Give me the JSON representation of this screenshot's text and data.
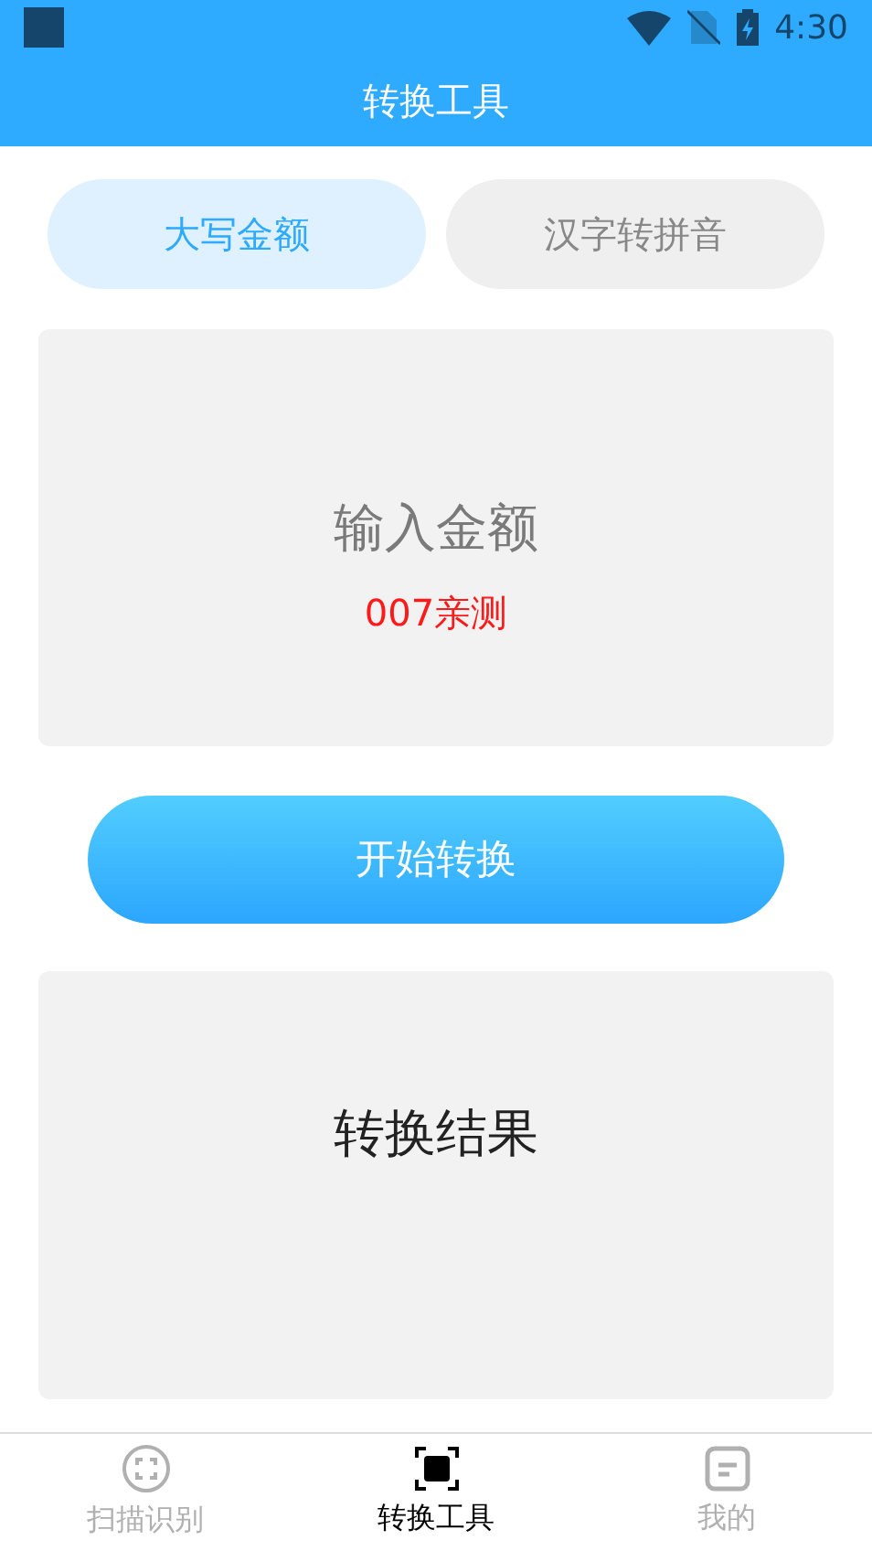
{
  "status_bar": {
    "time": "4:30"
  },
  "header": {
    "title": "转换工具"
  },
  "tabs": [
    {
      "label": "大写金额",
      "selected": true
    },
    {
      "label": "汉字转拼音",
      "selected": false
    }
  ],
  "input": {
    "placeholder": "输入金额",
    "note": "007亲测"
  },
  "convert_button": {
    "label": "开始转换"
  },
  "result": {
    "text": "转换结果"
  },
  "bottom_nav": [
    {
      "label": "扫描识别",
      "kind": "scan",
      "selected": false
    },
    {
      "label": "转换工具",
      "kind": "convert",
      "selected": true
    },
    {
      "label": "我的",
      "kind": "profile",
      "selected": false
    }
  ]
}
